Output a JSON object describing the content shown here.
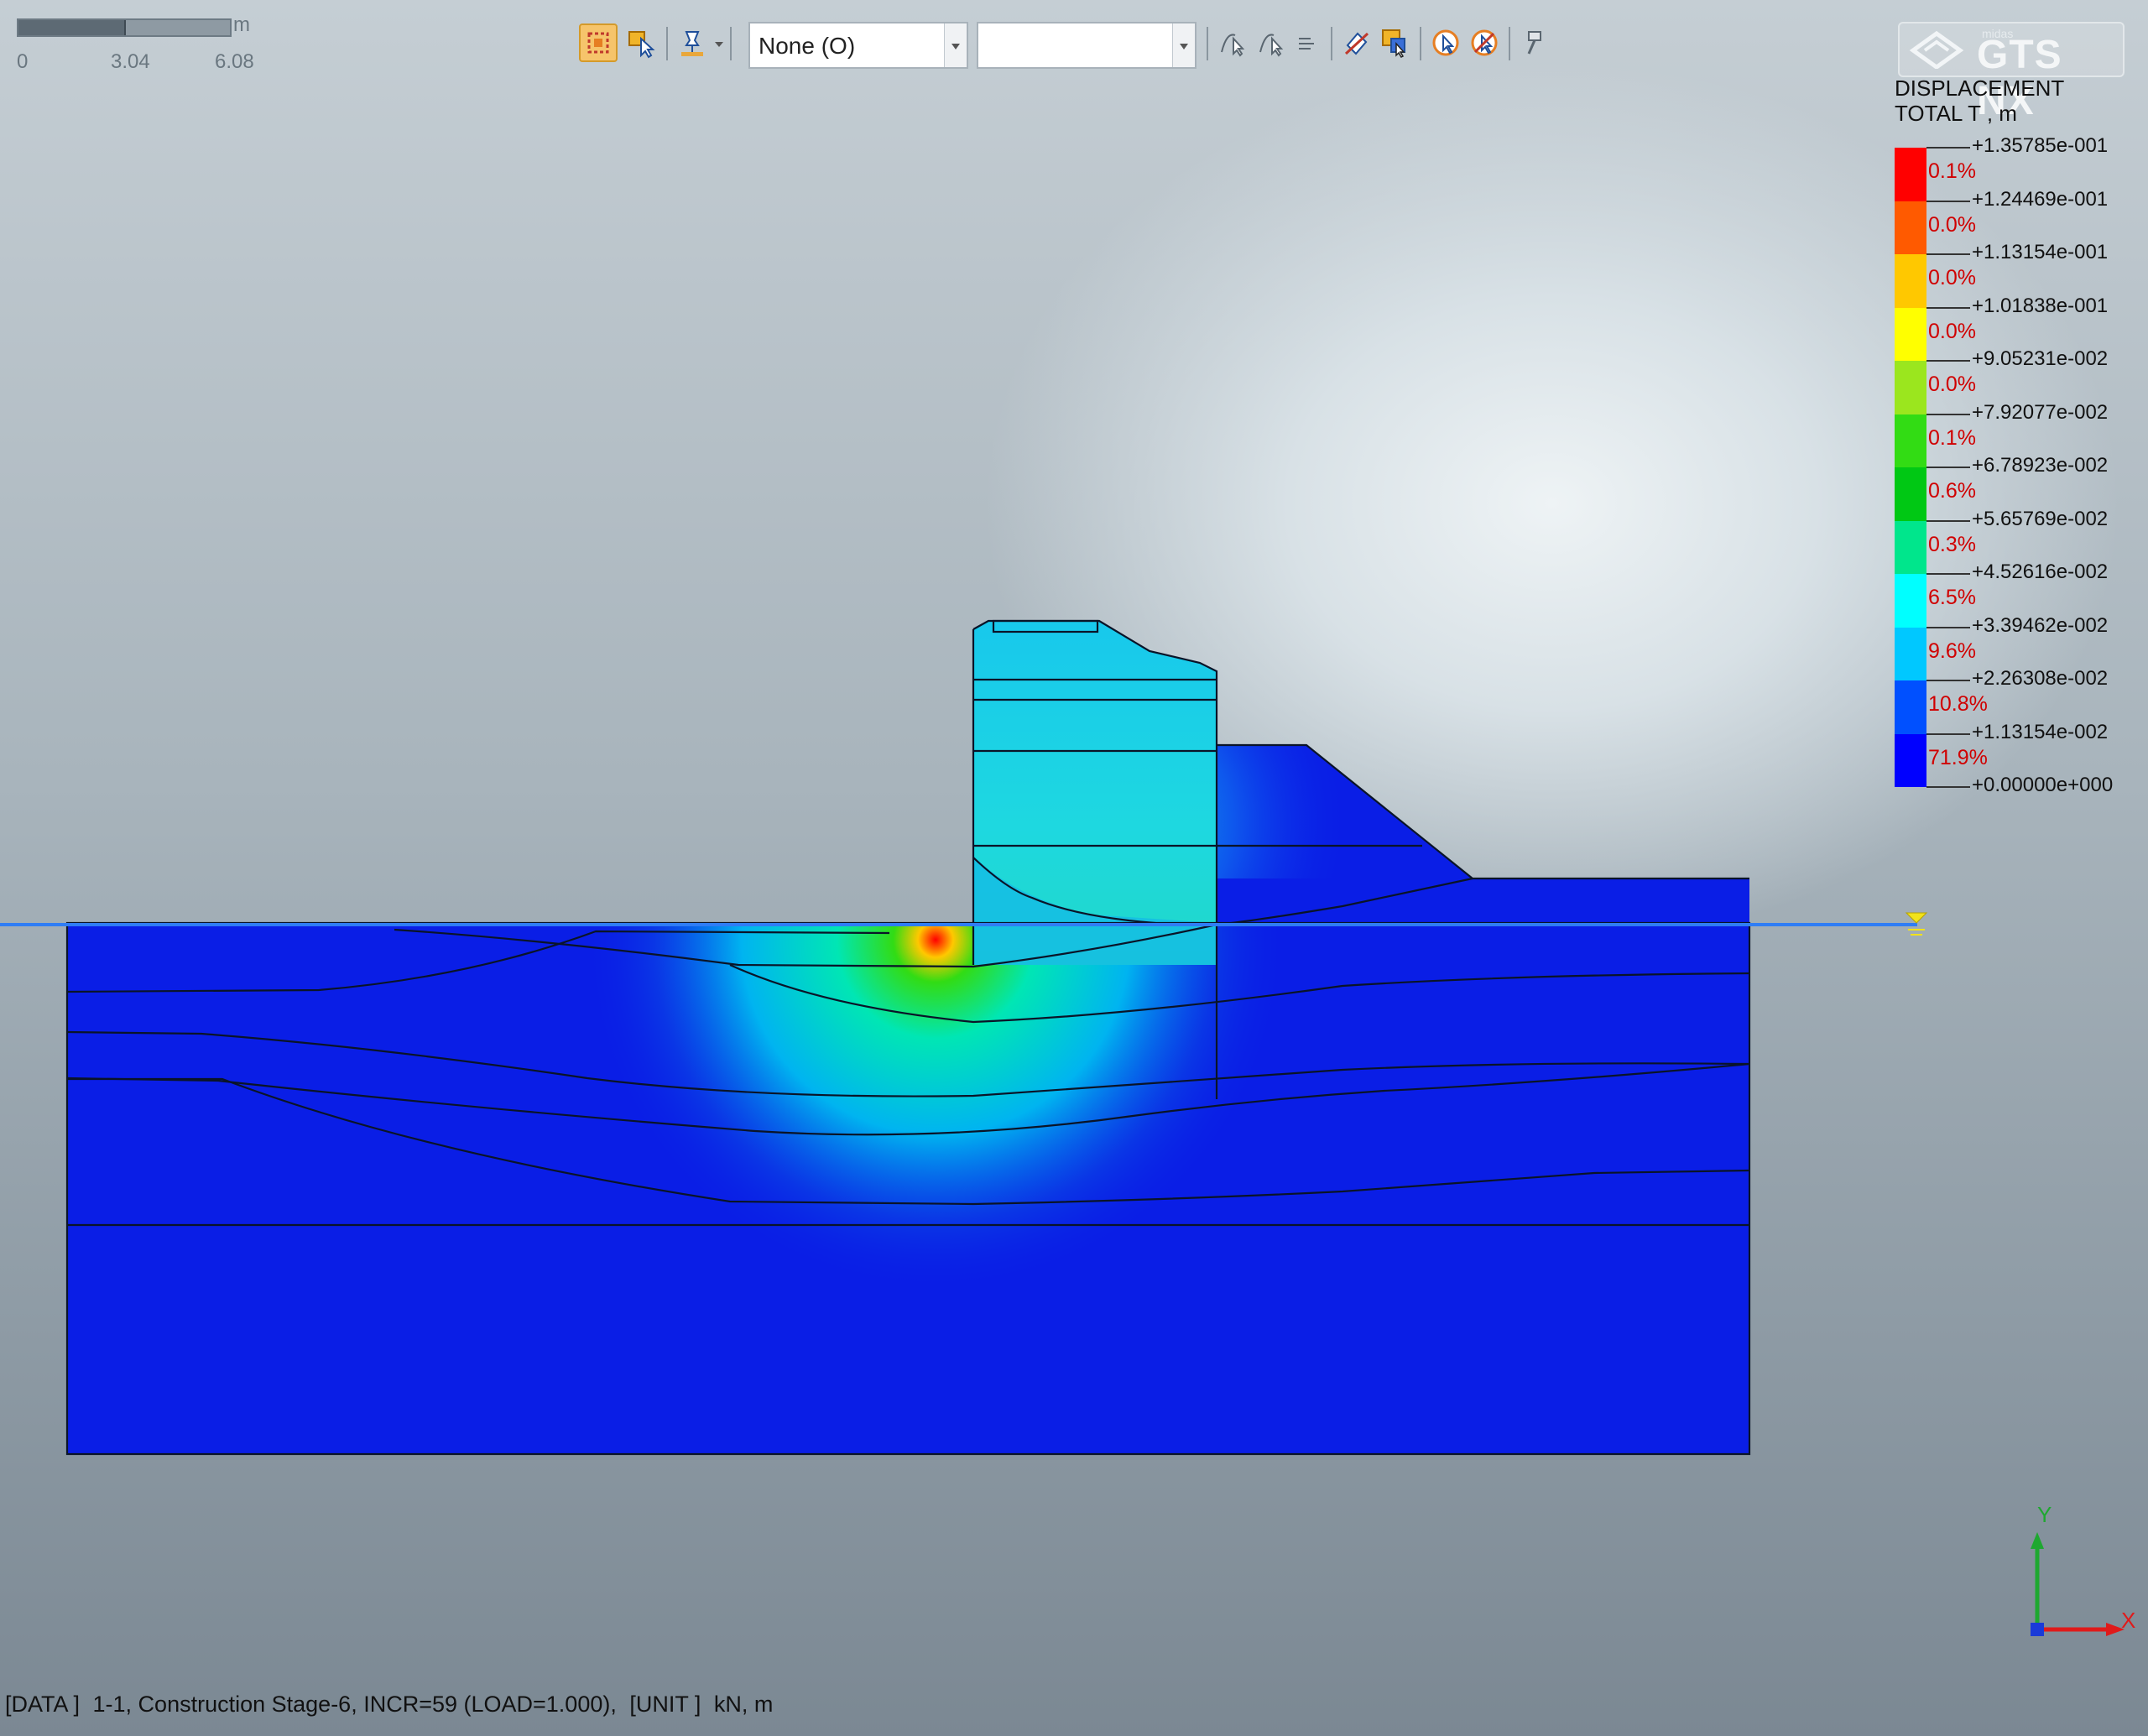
{
  "scale_bar": {
    "unit": "m",
    "ticks": [
      "0",
      "3.04",
      "6.08"
    ]
  },
  "toolbar": {
    "select_dropdown": {
      "value": "None (O)"
    },
    "second_dropdown": {
      "value": ""
    },
    "icons": [
      "select-mode-icon",
      "pick-mode-icon",
      "probe-icon",
      "curve-select-icon",
      "curve-select-2-icon",
      "list-icon",
      "clear-icon",
      "highlight-icon",
      "start-icon",
      "stop-icon",
      "pin-icon"
    ]
  },
  "logo": {
    "small": "midas",
    "big": "GTS NX"
  },
  "legend": {
    "title_line1": "DISPLACEMENT",
    "title_line2": "TOTAL T , m",
    "colors": [
      "#ff0000",
      "#ff5a00",
      "#ffc800",
      "#ffff00",
      "#9be61e",
      "#32dc14",
      "#00c814",
      "#00e68c",
      "#00ffff",
      "#00c8ff",
      "#0050ff",
      "#0000ff"
    ],
    "values": [
      "+1.35785e-001",
      "+1.24469e-001",
      "+1.13154e-001",
      "+1.01838e-001",
      "+9.05231e-002",
      "+7.92077e-002",
      "+6.78923e-002",
      "+5.65769e-002",
      "+4.52616e-002",
      "+3.39462e-002",
      "+2.26308e-002",
      "+1.13154e-002",
      "+0.00000e+000"
    ],
    "percents": [
      "0.1%",
      "0.0%",
      "0.0%",
      "0.0%",
      "0.0%",
      "0.1%",
      "0.6%",
      "0.3%",
      "6.5%",
      "9.6%",
      "10.8%",
      "71.9%"
    ]
  },
  "status": {
    "data_tag": "[DATA ]",
    "data_value": "1-1,  Construction Stage-6,  INCR=59 (LOAD=1.000),",
    "unit_tag": "[UNIT ]",
    "unit_value": "kN,  m"
  },
  "axis": {
    "y": "Y",
    "x": "X"
  }
}
